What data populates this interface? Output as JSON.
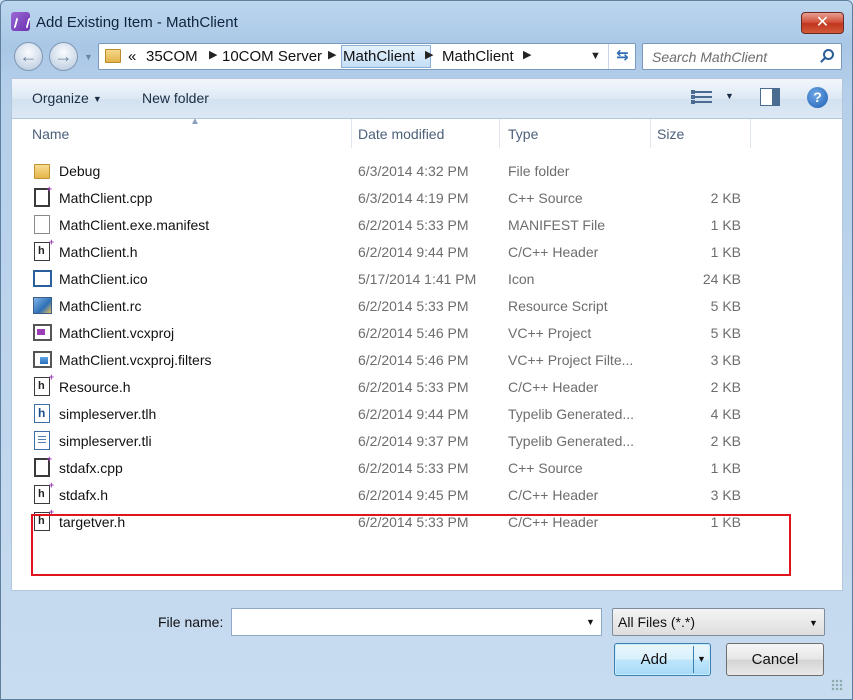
{
  "window": {
    "title": "Add Existing Item - MathClient",
    "close_glyph": "✕"
  },
  "address_bar": {
    "overflow": "«",
    "crumbs": [
      "35COM",
      "10COM Server",
      "MathClient",
      "MathClient"
    ],
    "search_placeholder": "Search MathClient"
  },
  "toolbar": {
    "organize_label": "Organize",
    "new_folder_label": "New folder",
    "help_glyph": "?"
  },
  "columns": {
    "name": "Name",
    "date_modified": "Date modified",
    "type": "Type",
    "size": "Size"
  },
  "files": [
    {
      "name": "Debug",
      "date": "6/3/2014 4:32 PM",
      "type": "File folder",
      "size": "",
      "icon": "folder-icon"
    },
    {
      "name": "MathClient.cpp",
      "date": "6/3/2014 4:19 PM",
      "type": "C++ Source",
      "size": "2 KB",
      "icon": "cpp-file-icon"
    },
    {
      "name": "MathClient.exe.manifest",
      "date": "6/2/2014 5:33 PM",
      "type": "MANIFEST File",
      "size": "1 KB",
      "icon": "document-icon"
    },
    {
      "name": "MathClient.h",
      "date": "6/2/2014 9:44 PM",
      "type": "C/C++ Header",
      "size": "1 KB",
      "icon": "header-file-icon"
    },
    {
      "name": "MathClient.ico",
      "date": "5/17/2014 1:41 PM",
      "type": "Icon",
      "size": "24 KB",
      "icon": "icon-file-icon"
    },
    {
      "name": "MathClient.rc",
      "date": "6/2/2014 5:33 PM",
      "type": "Resource Script",
      "size": "5 KB",
      "icon": "resource-script-icon"
    },
    {
      "name": "MathClient.vcxproj",
      "date": "6/2/2014 5:46 PM",
      "type": "VC++ Project",
      "size": "5 KB",
      "icon": "project-file-icon"
    },
    {
      "name": "MathClient.vcxproj.filters",
      "date": "6/2/2014 5:46 PM",
      "type": "VC++ Project Filte...",
      "size": "3 KB",
      "icon": "filters-file-icon"
    },
    {
      "name": "Resource.h",
      "date": "6/2/2014 5:33 PM",
      "type": "C/C++ Header",
      "size": "2 KB",
      "icon": "header-file-icon"
    },
    {
      "name": "simpleserver.tlh",
      "date": "6/2/2014 9:44 PM",
      "type": "Typelib Generated...",
      "size": "4 KB",
      "icon": "typelib-header-icon"
    },
    {
      "name": "simpleserver.tli",
      "date": "6/2/2014 9:37 PM",
      "type": "Typelib Generated...",
      "size": "2 KB",
      "icon": "typelib-impl-icon"
    },
    {
      "name": "stdafx.cpp",
      "date": "6/2/2014 5:33 PM",
      "type": "C++ Source",
      "size": "1 KB",
      "icon": "cpp-file-icon"
    },
    {
      "name": "stdafx.h",
      "date": "6/2/2014 9:45 PM",
      "type": "C/C++ Header",
      "size": "3 KB",
      "icon": "header-file-icon"
    },
    {
      "name": "targetver.h",
      "date": "6/2/2014 5:33 PM",
      "type": "C/C++ Header",
      "size": "1 KB",
      "icon": "header-file-icon"
    }
  ],
  "bottom": {
    "file_name_label": "File name:",
    "file_name_value": "",
    "filter_value": "All Files (*.*)",
    "add_label": "Add",
    "cancel_label": "Cancel"
  },
  "colors": {
    "highlight_box": "#e0141c",
    "close_button": "#c0351f"
  }
}
